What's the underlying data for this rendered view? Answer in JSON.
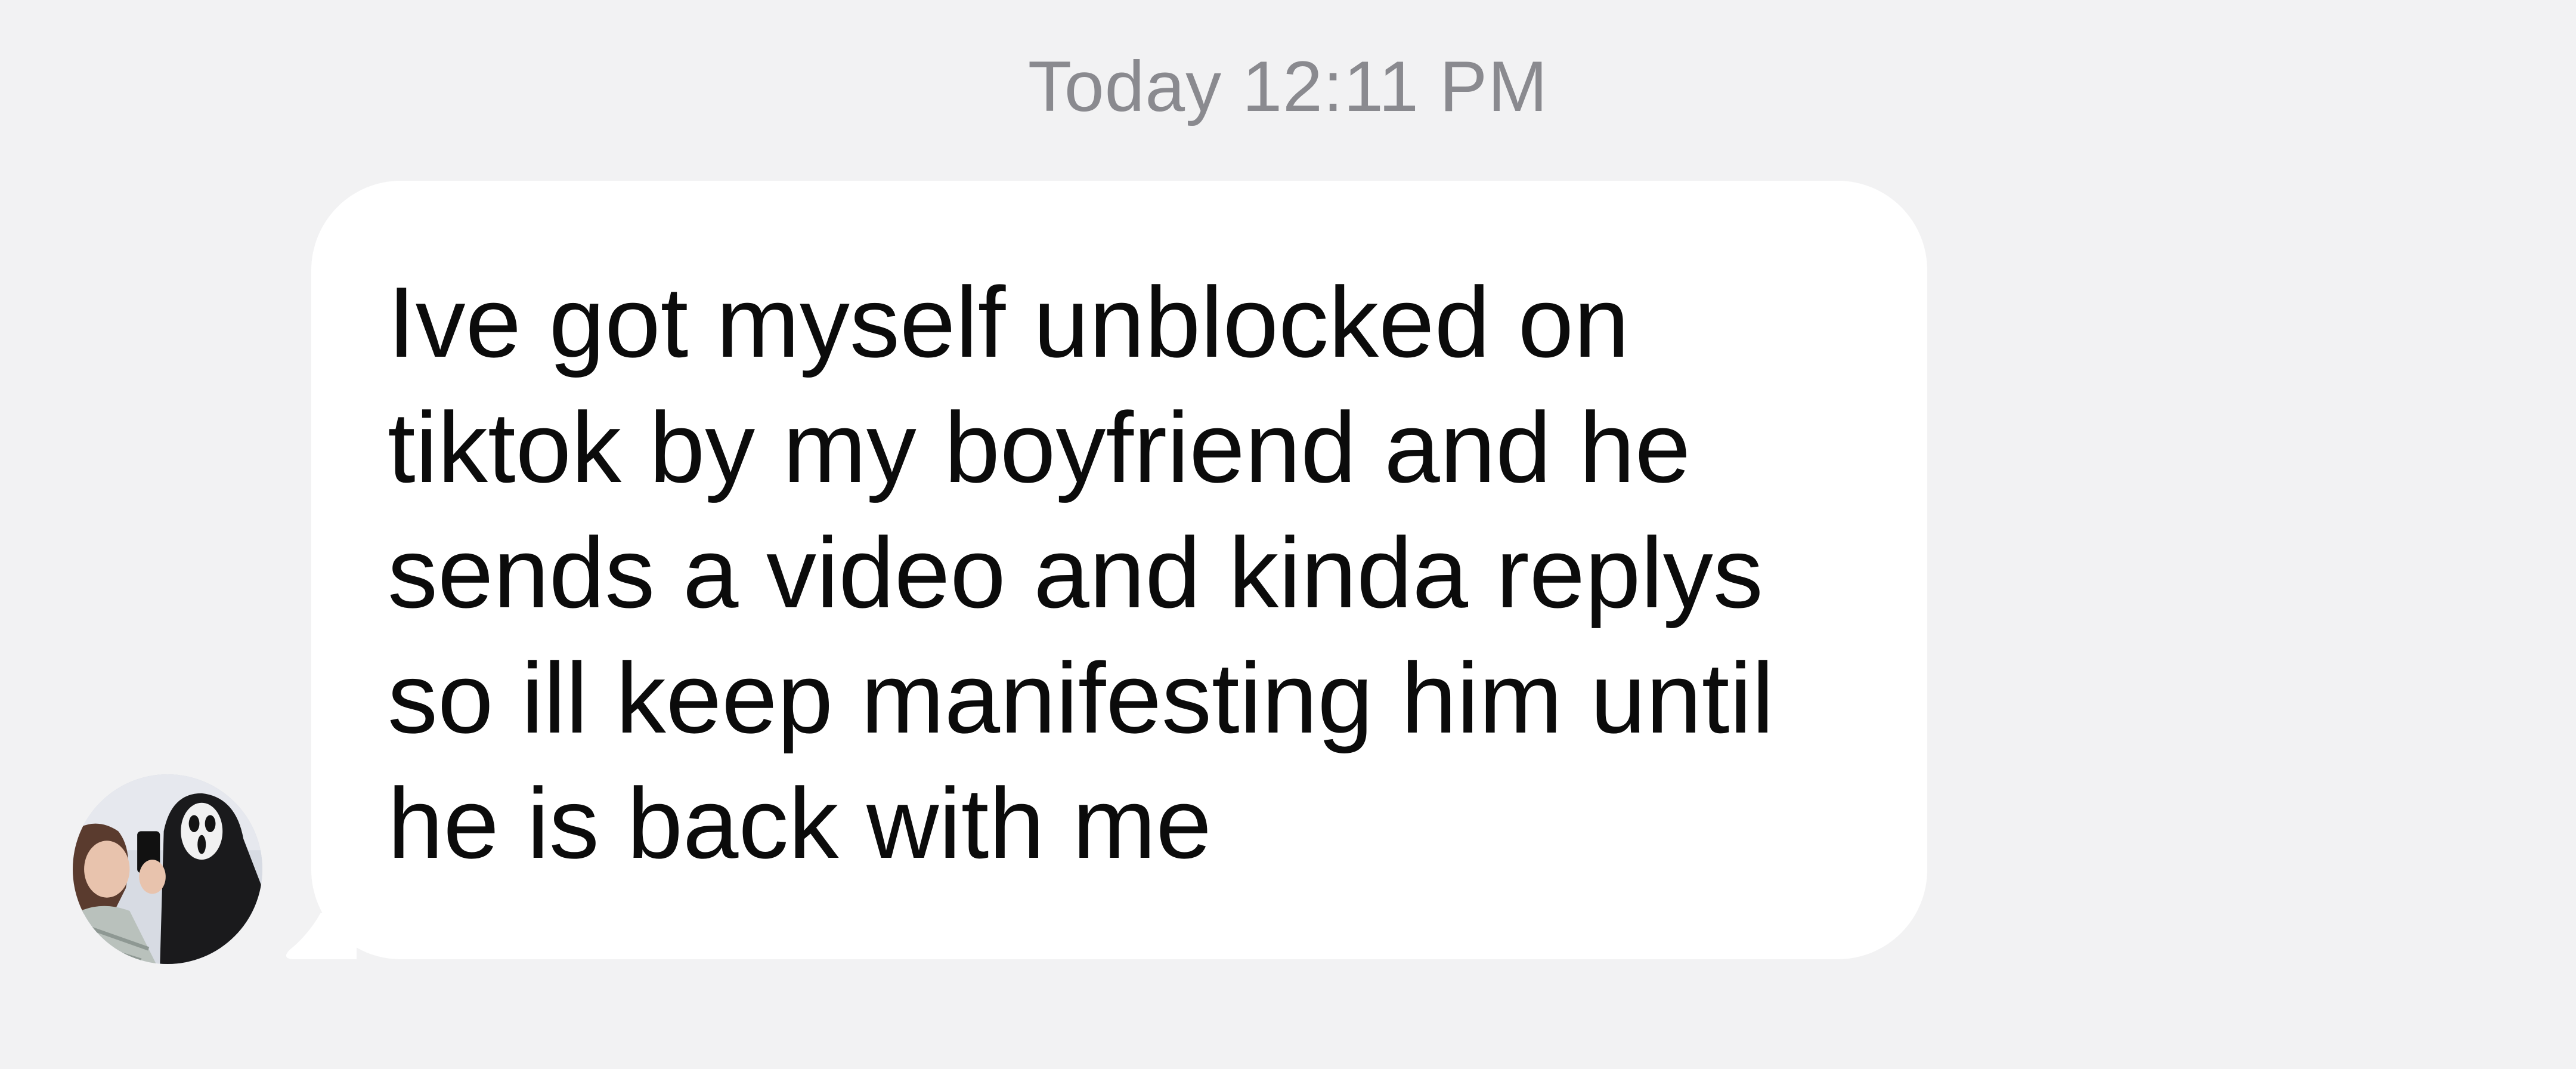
{
  "thread": {
    "timestamp": "Today 12:11 PM",
    "messages": [
      {
        "sender": "other",
        "avatar_icon": "profile-photo-avatar",
        "text": "Ive got myself unblocked on\ntiktok by my boyfriend and he\nsends a video and kinda replys\nso ill keep manifesting him until\nhe is back with me"
      }
    ]
  },
  "colors": {
    "background": "#f2f2f3",
    "bubble": "#ffffff",
    "text": "#0b0b0b",
    "timestamp": "#8a8a8f"
  }
}
